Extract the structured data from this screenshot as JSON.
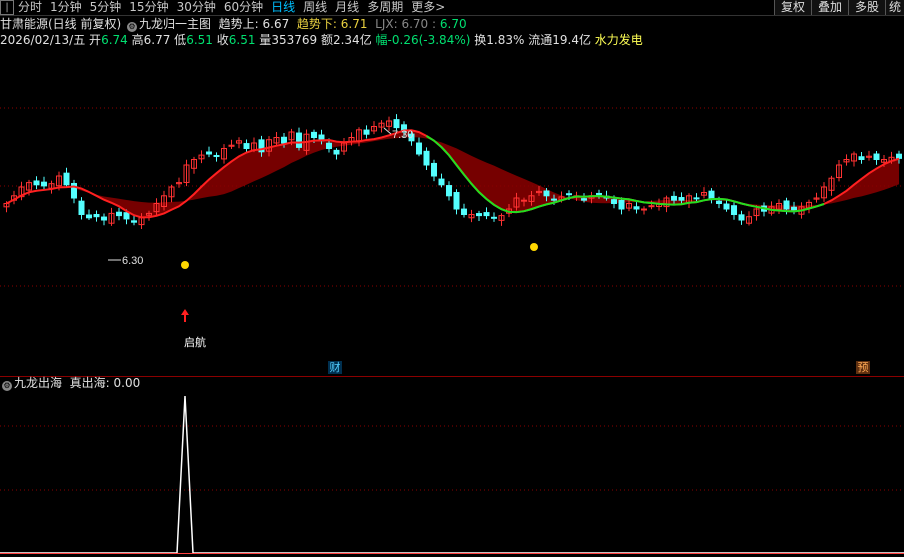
{
  "toolbar": {
    "periods": [
      "分时",
      "1分钟",
      "5分钟",
      "15分钟",
      "30分钟",
      "60分钟",
      "日线",
      "周线",
      "月线",
      "多周期",
      "更多>"
    ],
    "active_period": "日线",
    "right_buttons": [
      "复权",
      "叠加",
      "多股",
      "统"
    ]
  },
  "header": {
    "stock": "甘肃能源(日线 前复权)",
    "indicator": "九龙归一主图",
    "trend_up_label": "趋势上:",
    "trend_up_value": "6.67",
    "trend_down_label": "趋势下:",
    "trend_down_value": "6.71",
    "ljx_label": "LJX:",
    "ljx_value_1": "6.70",
    "ljx_value_2": "6.70"
  },
  "quote": {
    "date": "2026/02/13/五",
    "open_label": "开",
    "open": "6.74",
    "high_label": "高",
    "high": "6.77",
    "low_label": "低",
    "low": "6.51",
    "close_label": "收",
    "close": "6.51",
    "volume_label": "量",
    "volume": "353769",
    "amount_label": "额",
    "amount": "2.34亿",
    "change_label": "幅",
    "change": "-0.26(-3.84%)",
    "turnover_label": "换",
    "turnover": "1.83%",
    "float_label": "流通",
    "float": "19.4亿",
    "sector": "水力发电"
  },
  "annotations": {
    "high_mark": "7.30",
    "low_mark": "6.30",
    "signal_label": "启航",
    "badge_fin": "财",
    "badge_pre": "预"
  },
  "sub_indicator": {
    "name": "九龙出海",
    "value_label": "真出海:",
    "value": "0.00"
  },
  "colors": {
    "up": "#ff3232",
    "down": "#54ffff",
    "trend_up_line": "#ff2020",
    "trend_down_line": "#20e020",
    "band_red": "#8b0000",
    "band_green": "#004a1a",
    "signal_dot": "#ffd700",
    "grid": "#8b0000"
  }
}
